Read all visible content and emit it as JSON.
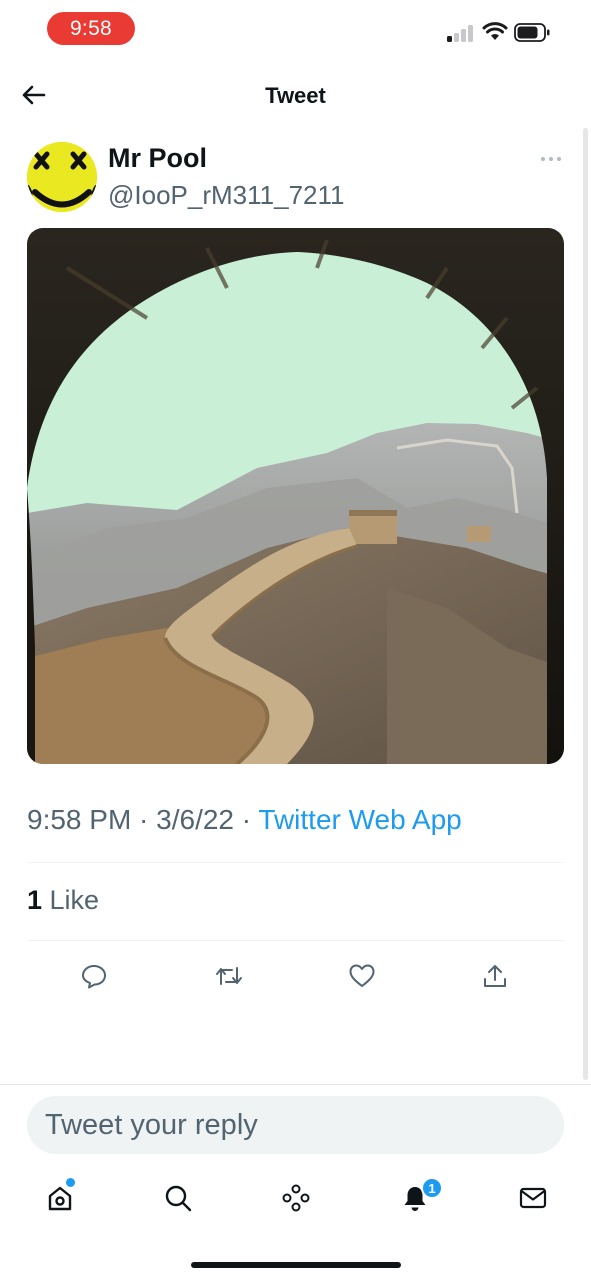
{
  "status_bar": {
    "time": "9:58",
    "icons": [
      "signal-icon",
      "wifi-icon",
      "battery-icon"
    ]
  },
  "header": {
    "title": "Tweet",
    "back_icon": "back-arrow-icon"
  },
  "tweet": {
    "author": {
      "display_name": "Mr Pool",
      "handle": "@IooP_rM311_7211",
      "avatar_icon": "avatar-yellow-face"
    },
    "more_icon": "more-icon",
    "image_alt": "Great Wall through stone arch",
    "timestamp": "9:58 PM · 3/6/22 · ",
    "source": "Twitter Web App",
    "likes_count": "1",
    "likes_label": " Like",
    "actions": [
      "reply-icon",
      "retweet-icon",
      "like-icon",
      "share-icon"
    ]
  },
  "reply": {
    "placeholder": "Tweet your reply"
  },
  "bottom_nav": {
    "items": [
      "home-icon",
      "search-icon",
      "spaces-icon",
      "notifications-icon",
      "messages-icon"
    ],
    "notification_badge": "1"
  },
  "colors": {
    "accent": "#1d9bf0",
    "time_pill": "#ea3a34",
    "secondary_text": "#536471"
  }
}
